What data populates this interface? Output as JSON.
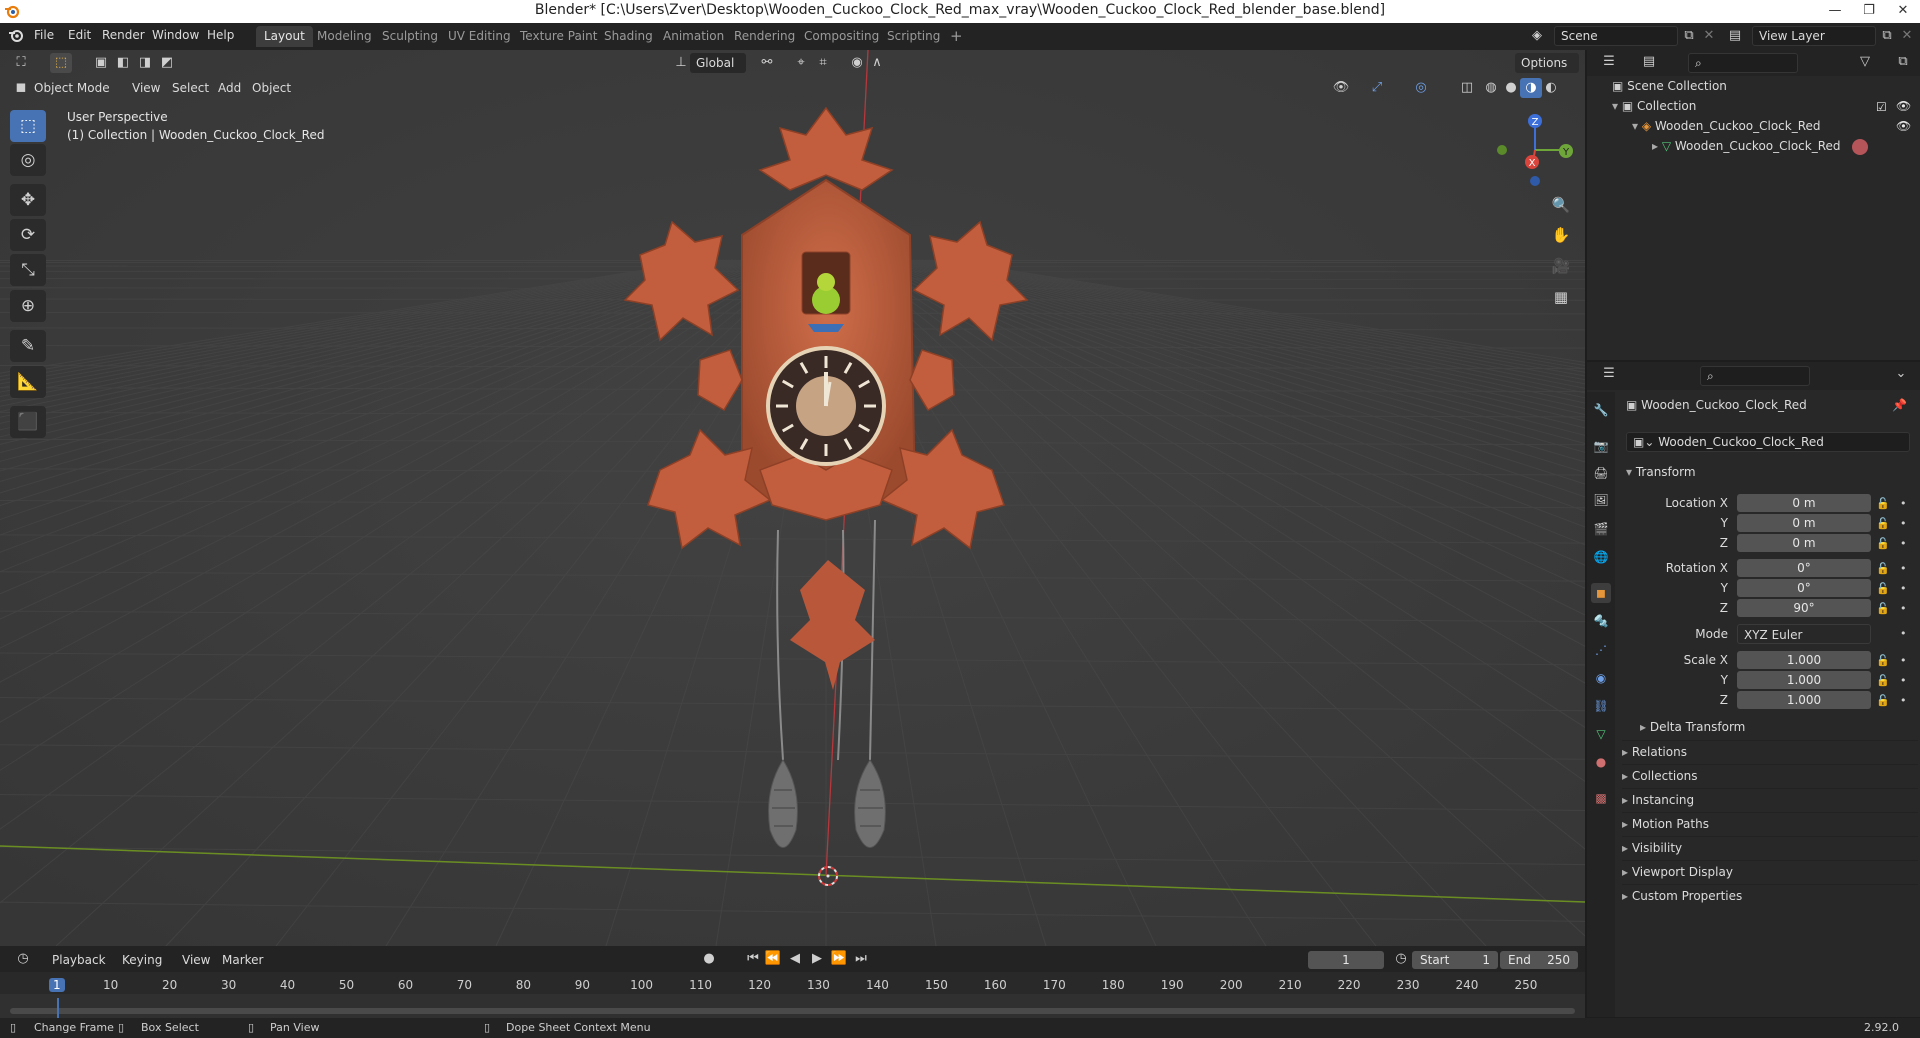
{
  "window": {
    "title": "Blender* [C:\\Users\\Zver\\Desktop\\Wooden_Cuckoo_Clock_Red_max_vray\\Wooden_Cuckoo_Clock_Red_blender_base.blend]"
  },
  "menu": [
    "File",
    "Edit",
    "Render",
    "Window",
    "Help"
  ],
  "workspaces": [
    {
      "label": "Layout",
      "active": true
    },
    {
      "label": "Modeling"
    },
    {
      "label": "Sculpting"
    },
    {
      "label": "UV Editing"
    },
    {
      "label": "Texture Paint"
    },
    {
      "label": "Shading"
    },
    {
      "label": "Animation"
    },
    {
      "label": "Rendering"
    },
    {
      "label": "Compositing"
    },
    {
      "label": "Scripting"
    }
  ],
  "scene": {
    "label": "Scene"
  },
  "view_layer": {
    "label": "View Layer"
  },
  "viewport": {
    "mode": "Object Mode",
    "header_menu": [
      "View",
      "Select",
      "Add",
      "Object"
    ],
    "transform_orientation": "Global",
    "options": "Options",
    "info_line1": "User Perspective",
    "info_line2": "(1) Collection | Wooden_Cuckoo_Clock_Red",
    "gizmo_axes": {
      "z": "Z",
      "y": "Y",
      "x": "X"
    }
  },
  "outliner": {
    "scene_collection": "Scene Collection",
    "collection": "Collection",
    "object": "Wooden_Cuckoo_Clock_Red",
    "mesh": "Wooden_Cuckoo_Clock_Red"
  },
  "properties": {
    "object_name_header": "Wooden_Cuckoo_Clock_Red",
    "object_name_field": "Wooden_Cuckoo_Clock_Red",
    "transform_title": "Transform",
    "location_label": "Location X",
    "y_label": "Y",
    "z_label": "Z",
    "location": [
      "0 m",
      "0 m",
      "0 m"
    ],
    "rotation_label": "Rotation X",
    "rotation": [
      "0°",
      "0°",
      "90°"
    ],
    "mode_label": "Mode",
    "mode": "XYZ Euler",
    "scale_label": "Scale X",
    "scale": [
      "1.000",
      "1.000",
      "1.000"
    ],
    "delta_transform": "Delta Transform",
    "panels": [
      "Relations",
      "Collections",
      "Instancing",
      "Motion Paths",
      "Visibility",
      "Viewport Display",
      "Custom Properties"
    ]
  },
  "timeline": {
    "menu": [
      "Playback",
      "Keying",
      "View",
      "Marker"
    ],
    "current_frame": "1",
    "start_label": "Start",
    "start": "1",
    "end_label": "End",
    "end": "250",
    "ticks": [
      "1",
      "10",
      "20",
      "30",
      "40",
      "50",
      "60",
      "70",
      "80",
      "90",
      "100",
      "110",
      "120",
      "130",
      "140",
      "150",
      "160",
      "170",
      "180",
      "190",
      "200",
      "210",
      "220",
      "230",
      "240",
      "250"
    ]
  },
  "statusbar": {
    "items": [
      "Change Frame",
      "Box Select",
      "Pan View",
      "Dope Sheet Context Menu"
    ],
    "version": "2.92.0"
  },
  "colors": {
    "accent": "#4772b3",
    "clock_wood": "#c0603e"
  }
}
